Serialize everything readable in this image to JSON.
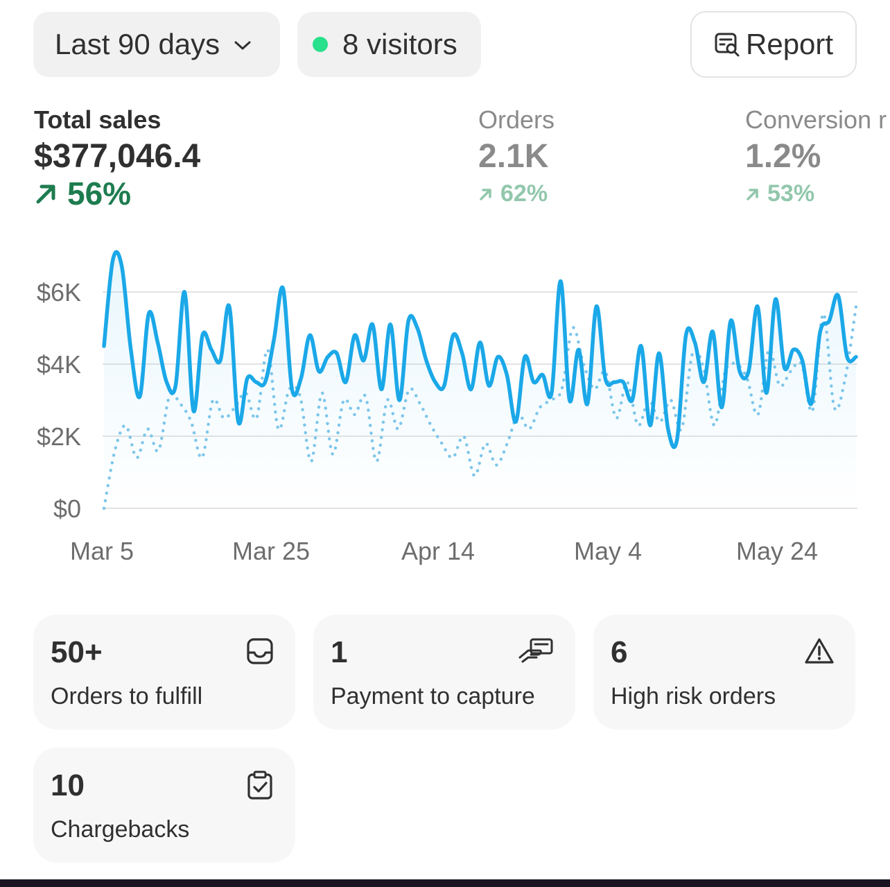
{
  "toolbar": {
    "date_range_label": "Last 90 days",
    "visitors_label": "8 visitors",
    "report_label": "Report",
    "live_dot_color": "#29e08c"
  },
  "metrics": {
    "total_sales": {
      "label": "Total sales",
      "value": "$377,046.4",
      "delta": "56%"
    },
    "orders": {
      "label": "Orders",
      "value": "2.1K",
      "delta": "62%"
    },
    "conversion": {
      "label": "Conversion r",
      "value": "1.2%",
      "delta": "53%"
    }
  },
  "chart_data": {
    "type": "line",
    "x_ticks": [
      "Mar 5",
      "Mar 25",
      "Apr 14",
      "May 4",
      "May 24"
    ],
    "y_ticks": [
      "$0",
      "$2K",
      "$4K",
      "$6K"
    ],
    "ylim": [
      0,
      7000
    ],
    "grid": true,
    "colors": {
      "current": "#1ba8e8",
      "previous": "#7dc6ea"
    },
    "series": [
      {
        "style": "solid",
        "values": [
          4500,
          6900,
          6700,
          4400,
          3100,
          5400,
          4600,
          3500,
          3400,
          6000,
          2700,
          4800,
          4400,
          4100,
          5600,
          2400,
          3600,
          3500,
          3500,
          4700,
          6100,
          3300,
          3600,
          4800,
          3800,
          4200,
          4300,
          3500,
          4800,
          4100,
          5100,
          3300,
          5100,
          3000,
          5200,
          5000,
          4100,
          3500,
          3400,
          4800,
          4300,
          3300,
          4600,
          3400,
          4200,
          3700,
          2400,
          4200,
          3500,
          3700,
          3200,
          6300,
          3000,
          4400,
          2900,
          5600,
          3600,
          3500,
          3500,
          3000,
          4500,
          2300,
          4300,
          2200,
          1900,
          4800,
          4600,
          3500,
          4900,
          2800,
          5200,
          3800,
          3800,
          5600,
          3200,
          5800,
          3900,
          4400,
          4100,
          2900,
          4900,
          5200,
          5900,
          4200,
          4200
        ],
        "dates": "daily from Mar 4 to May 28 (approx.)"
      },
      {
        "style": "dotted",
        "values": [
          0,
          1600,
          2300,
          1400,
          2200,
          1600,
          3100,
          2900,
          2400,
          1400,
          3000,
          2500,
          2800,
          3200,
          2500,
          4400,
          2200,
          3300,
          3100,
          1300,
          3200,
          1500,
          3000,
          2600,
          3100,
          1300,
          3000,
          2200,
          3300,
          2900,
          2300,
          1800,
          1400,
          2000,
          900,
          1800,
          1200,
          1800,
          2600,
          2200,
          2800,
          3000,
          3300,
          5000,
          4000,
          3300,
          3800,
          2500,
          3500,
          2300,
          3000,
          2400,
          3000,
          2200,
          4300,
          3900,
          2300,
          3800,
          4000,
          3600,
          2600,
          4400,
          3400,
          3800,
          4000,
          2700,
          5400,
          2800,
          3600,
          5600
        ],
        "dates": "previous period, daily (approx.)"
      }
    ]
  },
  "tiles": [
    {
      "count": "50+",
      "label": "Orders to fulfill",
      "icon": "inbox-icon"
    },
    {
      "count": "1",
      "label": "Payment to capture",
      "icon": "cash-hand-icon"
    },
    {
      "count": "6",
      "label": "High risk orders",
      "icon": "alert-triangle-icon"
    },
    {
      "count": "10",
      "label": "Chargebacks",
      "icon": "clipboard-check-icon"
    }
  ]
}
